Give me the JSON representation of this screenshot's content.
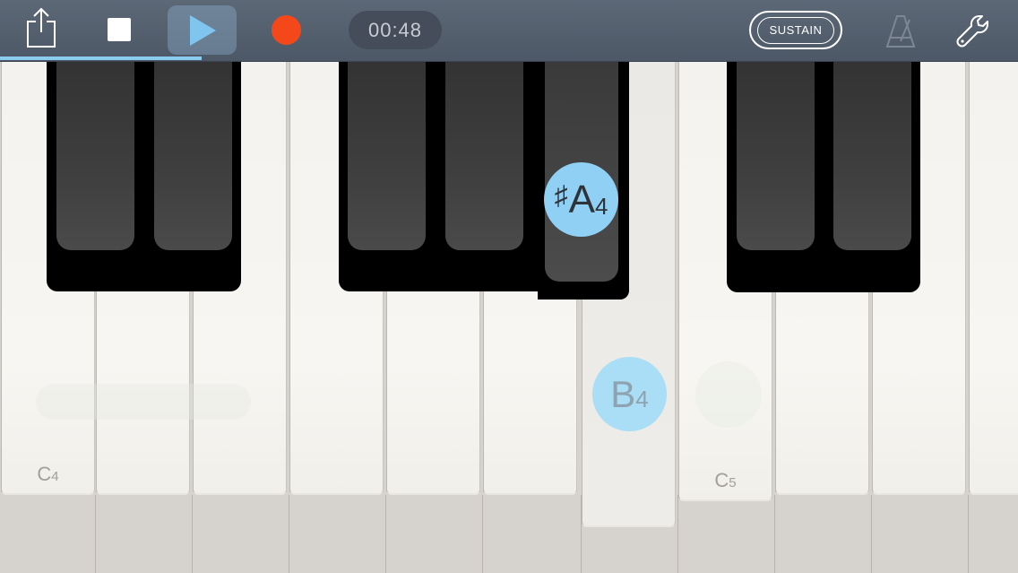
{
  "toolbar": {
    "timer": "00:48",
    "sustain_label": "SUSTAIN",
    "progress_fraction": 0.198,
    "icons": {
      "share": "share-icon",
      "stop": "stop-icon",
      "play": "play-icon",
      "record": "record-icon",
      "metronome": "metronome-icon",
      "settings": "wrench-icon"
    }
  },
  "keyboard": {
    "white_keys": [
      {
        "note": "C",
        "octave": "4",
        "show_label": true
      },
      {
        "note": "D",
        "octave": "4",
        "show_label": false
      },
      {
        "note": "E",
        "octave": "4",
        "show_label": false
      },
      {
        "note": "F",
        "octave": "4",
        "show_label": false
      },
      {
        "note": "G",
        "octave": "4",
        "show_label": false
      },
      {
        "note": "A",
        "octave": "4",
        "show_label": false
      },
      {
        "note": "B",
        "octave": "4",
        "show_label": false,
        "pressed": true
      },
      {
        "note": "C",
        "octave": "5",
        "show_label": true
      },
      {
        "note": "D",
        "octave": "5",
        "show_label": false
      },
      {
        "note": "E",
        "octave": "5",
        "show_label": false
      },
      {
        "note": "F",
        "octave": "5",
        "show_label": false
      }
    ],
    "labels": {
      "c4_note": "C",
      "c4_octave": "4",
      "c5_note": "C",
      "c5_octave": "5"
    },
    "active_notes": {
      "sharp_symbol": "♯",
      "sharp_note": "A",
      "sharp_octave": "4",
      "b_note": "B",
      "b_octave": "4"
    }
  },
  "colors": {
    "toolbar": "#5d6877",
    "accent_blue": "#8fd0f4",
    "record_red": "#f5481a",
    "progress": "#8ccbf0"
  }
}
